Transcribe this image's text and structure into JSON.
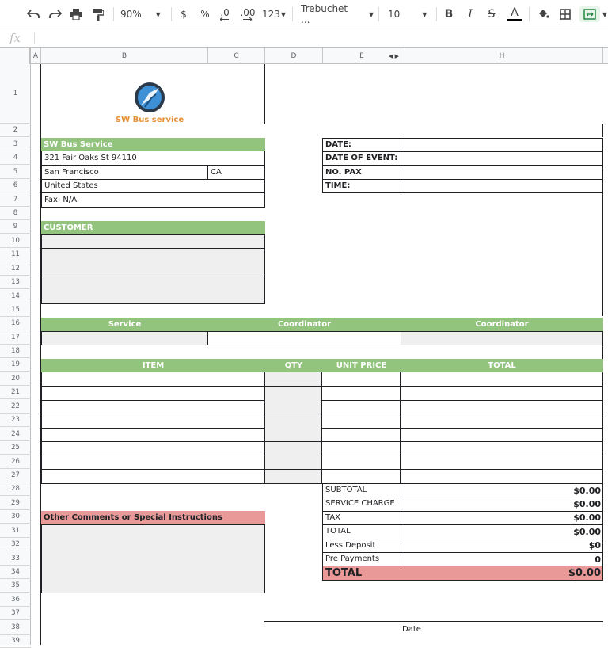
{
  "toolbar": {
    "zoom": "90%",
    "currency": "$",
    "percent": "%",
    "decrease_decimal": ".0",
    "increase_decimal": ".00",
    "number_format": "123",
    "font": "Trebuchet ...",
    "font_size": "10",
    "bold": "B",
    "italic": "I",
    "strike": "S",
    "text_color": "A"
  },
  "formula_bar": {
    "fx": "fx"
  },
  "columns": [
    "A",
    "B",
    "C",
    "D",
    "E",
    "H"
  ],
  "rows": [
    "1",
    "2",
    "3",
    "4",
    "5",
    "6",
    "7",
    "8",
    "9",
    "10",
    "11",
    "12",
    "13",
    "14",
    "15",
    "16",
    "17",
    "18",
    "19",
    "20",
    "21",
    "22",
    "23",
    "24",
    "25",
    "26",
    "27",
    "28",
    "29",
    "30",
    "31",
    "32",
    "33",
    "34",
    "35",
    "36",
    "37",
    "38",
    "39"
  ],
  "logo": {
    "text": "SW Bus service",
    "color": "#e69138"
  },
  "company": {
    "name": "SW Bus Service",
    "street": "321 Fair Oaks St 94110",
    "city": "San Francisco",
    "state": "CA",
    "country": "United States",
    "fax": "Fax: N/A"
  },
  "event": {
    "date_label": "DATE:",
    "date_of_event_label": "DATE OF EVENT:",
    "pax_label": "NO. PAX",
    "time_label": "TIME:"
  },
  "customer": {
    "header": "CUSTOMER"
  },
  "service_table": {
    "service": "Service",
    "coordinator1": "Coordinator",
    "coordinator2": "Coordinator"
  },
  "items_table": {
    "item": "ITEM",
    "qty": "QTY",
    "unit_price": "UNIT PRICE",
    "total": "TOTAL"
  },
  "comments": {
    "header": "Other Comments or Special Instructions"
  },
  "totals": {
    "subtotal_label": "SUBTOTAL",
    "subtotal": "$0.00",
    "service_charge_label": "SERVICE CHARGE",
    "service_charge": "$0.00",
    "tax_label": "TAX",
    "tax": "$0.00",
    "total_label": "TOTAL",
    "total": "$0.00",
    "deposit_label": "Less Deposit",
    "deposit": "$0",
    "pre_payments_label": "Pre Payments",
    "pre_payments": "0",
    "grand_total_label": "TOTAL",
    "grand_total": "$0.00"
  },
  "signature": {
    "date_label": "Date"
  },
  "colors": {
    "green": "#93c47d",
    "pink": "#ea9999",
    "gray": "#efefef"
  }
}
